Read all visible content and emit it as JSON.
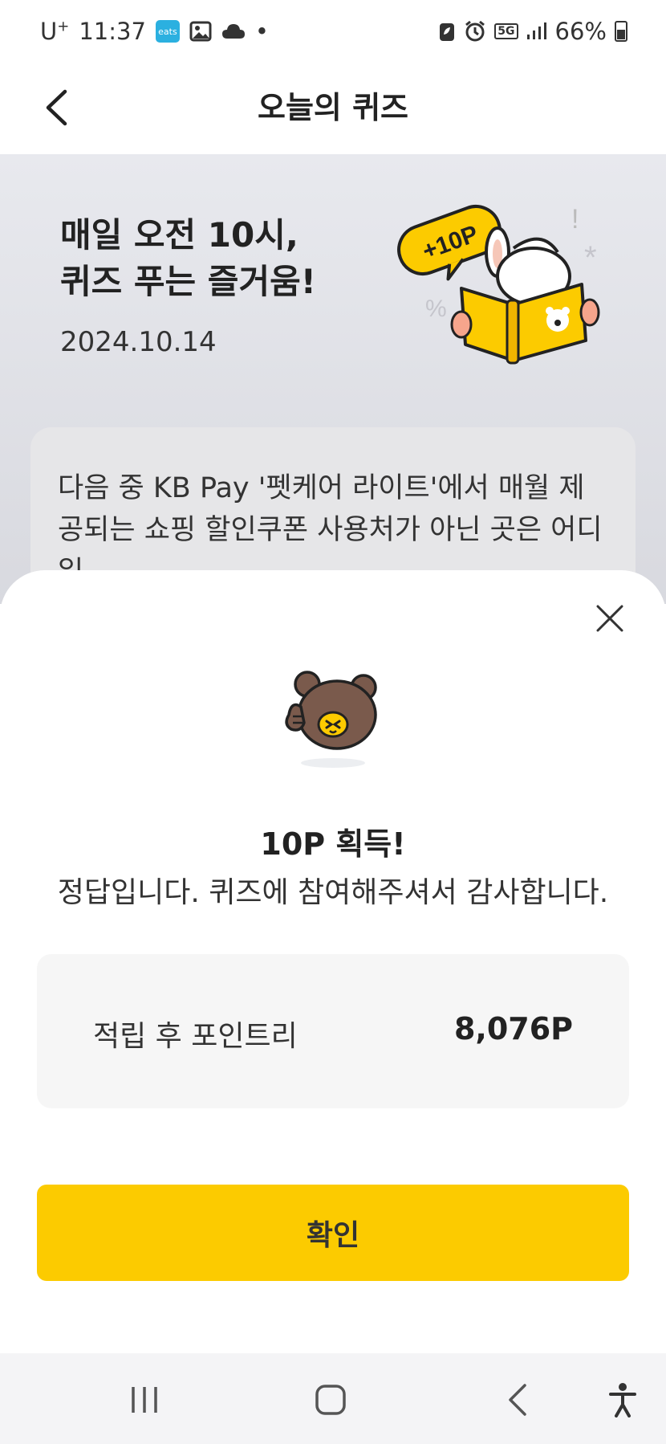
{
  "status_bar": {
    "carrier": "U",
    "carrier_plus": "+",
    "time": "11:37",
    "eats_label": "eats",
    "dot": "•",
    "network": "5G",
    "battery": "66%"
  },
  "header": {
    "title": "오늘의 퀴즈"
  },
  "promo": {
    "title_line1": "매일 오전 10시,",
    "title_line2": "퀴즈 푸는 즐거움!",
    "date": "2024.10.14",
    "badge": "+10P"
  },
  "question": {
    "text": "다음 중 KB Pay '펫케어 라이트'에서 매월 제공되는 쇼핑 할인쿠폰 사용처가 아닌 곳은 어디일"
  },
  "result_sheet": {
    "title": "10P 획득!",
    "message": "정답입니다. 퀴즈에 참여해주셔서 감사합니다.",
    "points_label": "적립 후 포인트리",
    "points_value": "8,076P",
    "confirm_label": "확인"
  },
  "colors": {
    "accent": "#fccb00",
    "sheet_bg": "#ffffff",
    "points_box_bg": "#f6f6f6"
  }
}
